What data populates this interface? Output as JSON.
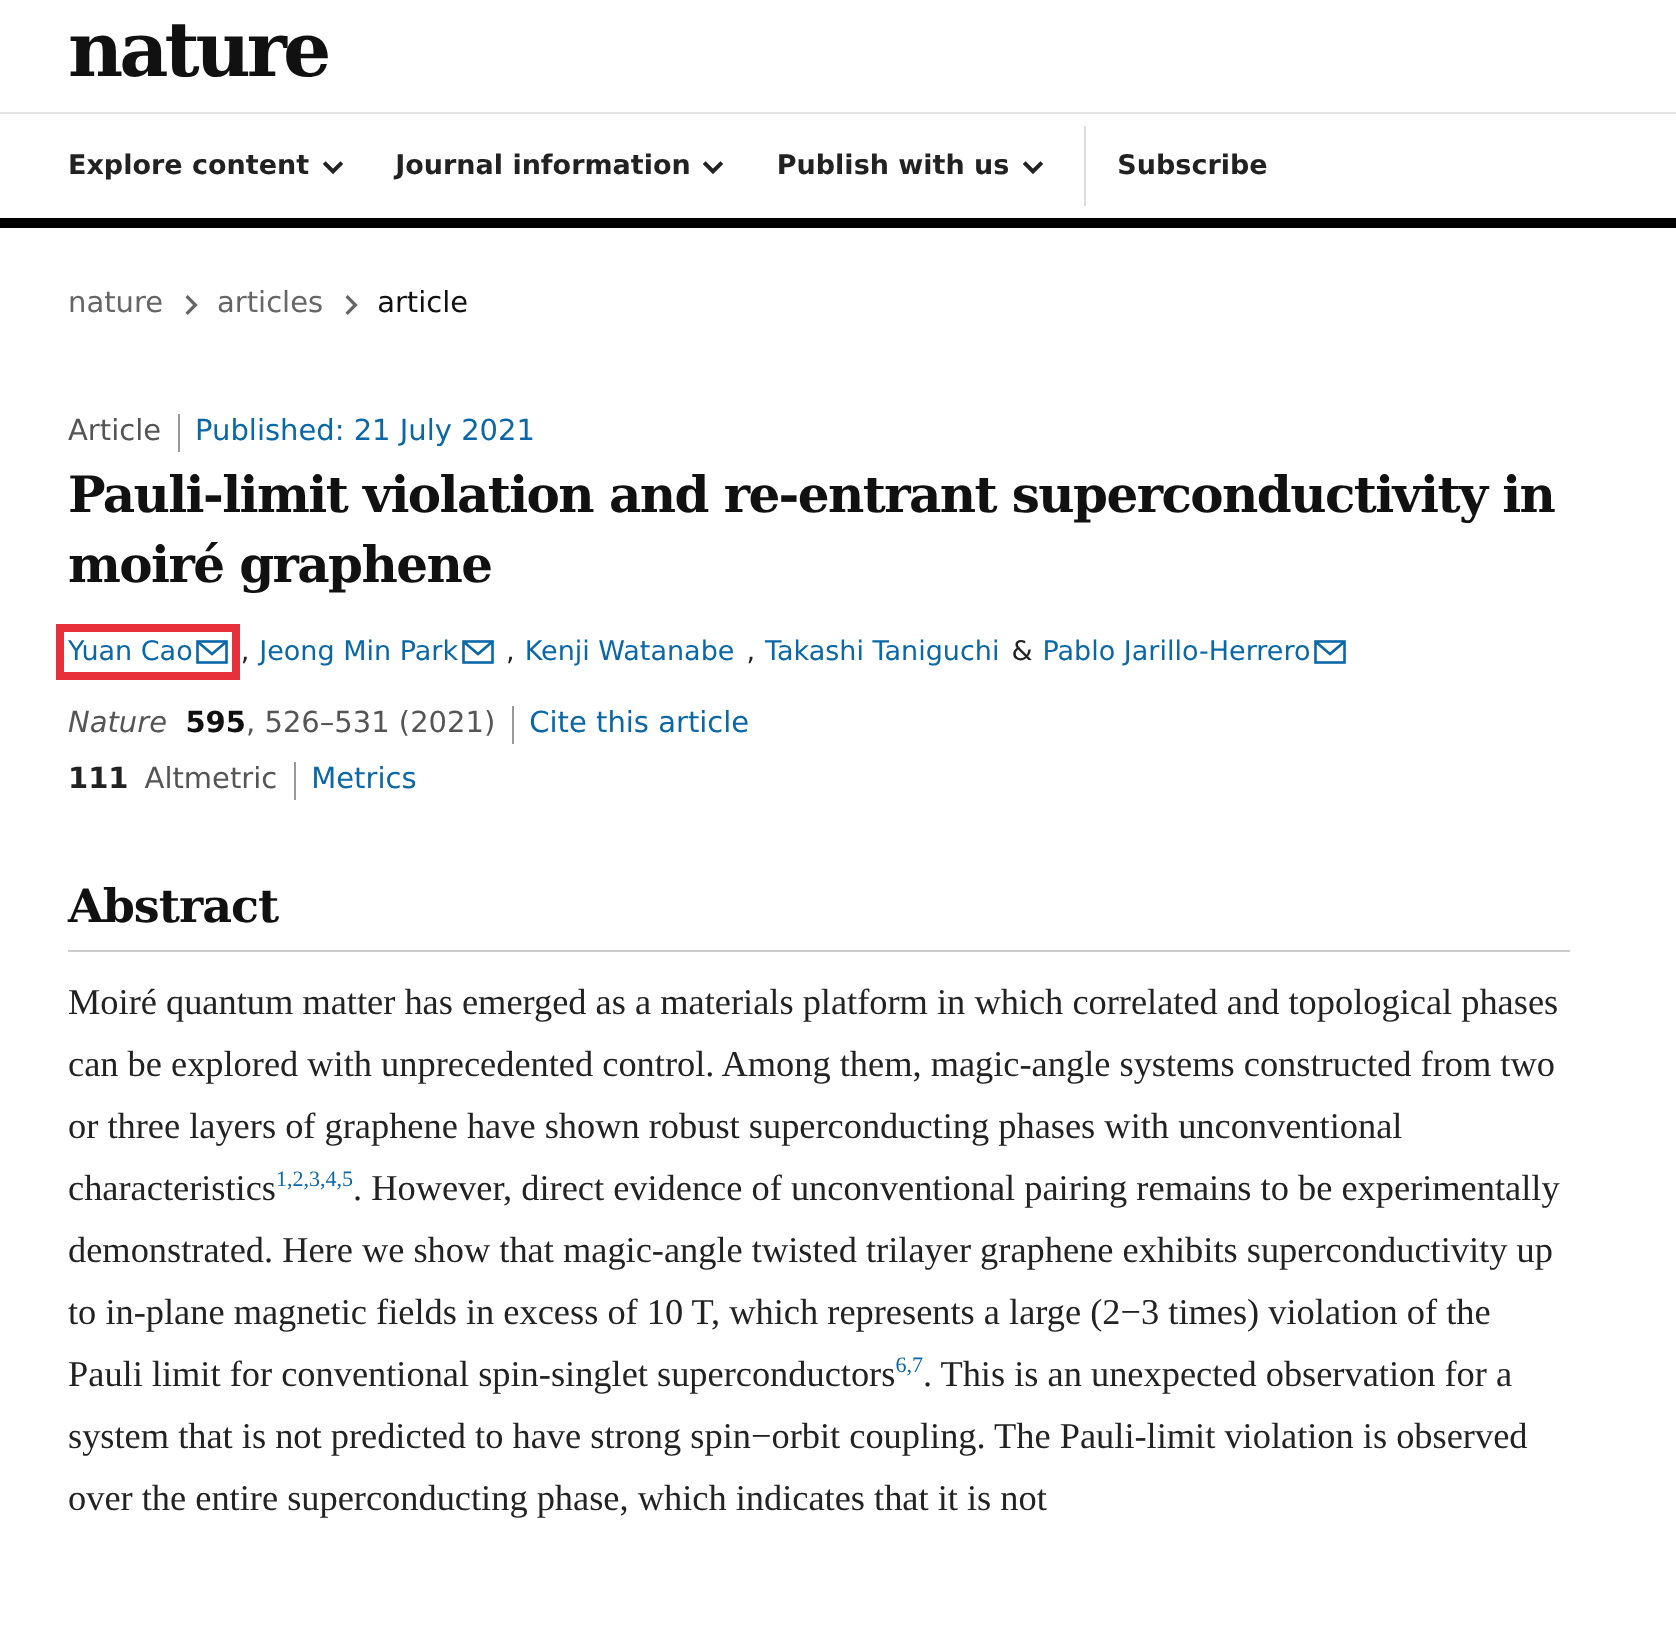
{
  "logo": "nature",
  "nav": [
    {
      "label": "Explore content",
      "dropdown": true
    },
    {
      "label": "Journal information",
      "dropdown": true
    },
    {
      "label": "Publish with us",
      "dropdown": true
    },
    {
      "label": "Subscribe",
      "dropdown": false
    }
  ],
  "breadcrumbs": [
    {
      "label": "nature",
      "current": false
    },
    {
      "label": "articles",
      "current": false
    },
    {
      "label": "article",
      "current": true
    }
  ],
  "article_type": "Article",
  "published": "Published: 21 July 2021",
  "title": "Pauli-limit violation and re-entrant superconductivity in moiré graphene",
  "authors": [
    {
      "name": "Yuan Cao",
      "email": true,
      "highlighted": true,
      "separator": ","
    },
    {
      "name": "Jeong Min Park",
      "email": true,
      "highlighted": false,
      "separator": ","
    },
    {
      "name": "Kenji Watanabe",
      "email": false,
      "highlighted": false,
      "separator": ","
    },
    {
      "name": "Takashi Taniguchi",
      "email": false,
      "highlighted": false,
      "separator": "&"
    },
    {
      "name": "Pablo Jarillo-Herrero",
      "email": true,
      "highlighted": false
    }
  ],
  "citation": {
    "journal": "Nature",
    "volume": "595",
    "pages": ", 526–531 (2021)",
    "link": "Cite this article"
  },
  "metrics": {
    "count": "111",
    "label": "Altmetric",
    "link": "Metrics"
  },
  "abstract": {
    "heading": "Abstract",
    "text": "Moiré quantum matter has emerged as a materials platform in which correlated and topological phases can be explored with unprecedented control. Among them, magic-angle systems constructed from two or three layers of graphene have shown robust superconducting phases with unconventional characteristics$^{1,2,3,4,5}$. However, direct evidence of unconventional pairing remains to be experimentally demonstrated. Here we show that magic-angle twisted trilayer graphene exhibits superconductivity up to in-plane magnetic fields in excess of 10 T, which represents a large (2−3 times) violation of the Pauli limit for conventional spin-singlet superconductors$^{6,7}$. This is an unexpected observation for a system that is not predicted to have strong spin−orbit coupling. The Pauli-limit violation is observed over the entire superconducting phase, which indicates that it is not"
  }
}
